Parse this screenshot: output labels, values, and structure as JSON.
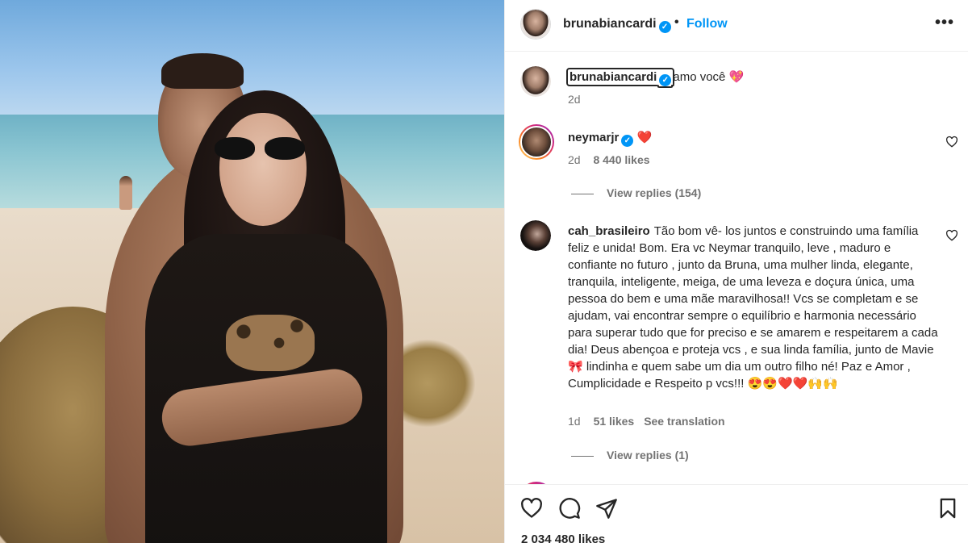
{
  "post": {
    "author": "brunabiancardi",
    "follow_label": "Follow",
    "more_label": "•••",
    "separator": "•"
  },
  "caption": {
    "username": "brunabiancardi",
    "text": "amo você",
    "emoji": "💖",
    "time": "2d"
  },
  "comments": [
    {
      "username": "neymarjr",
      "text": "❤️",
      "time": "2d",
      "likes": "8 440 likes",
      "replies": "View replies (154)"
    },
    {
      "username": "cah_brasileiro",
      "text": "Tão bom vê- los juntos e construindo uma família feliz e unida! Bom. Era vc Neymar tranquilo, leve , maduro e confiante no futuro , junto da Bruna, uma mulher linda, elegante, tranquila, inteligente, meiga, de uma leveza e doçura única, uma pessoa do bem e uma mãe maravilhosa!! Vcs se completam e se ajudam, vai encontrar sempre o equilíbrio e harmonia necessário para superar tudo que for preciso e se amarem e respeitarem a cada dia! Deus abençoa e proteja vcs , e sua linda família, junto de Mavie 🎀 lindinha e quem sabe um dia um outro filho né! Paz e Amor , Cumplicidade e Respeito p vcs!!! 😍😍❤️❤️🙌🙌",
      "time": "1d",
      "likes": "51 likes",
      "translate": "See translation",
      "replies": "View replies (1)"
    }
  ],
  "actions": {
    "like_icon": "heart-outline-icon",
    "comment_icon": "comment-bubble-icon",
    "share_icon": "paper-plane-icon",
    "save_icon": "bookmark-icon"
  },
  "total_likes": "2 034 480 likes",
  "colors": {
    "accent": "#0095f6",
    "text": "#262626",
    "muted": "#737373",
    "heart": "#ed4956"
  }
}
